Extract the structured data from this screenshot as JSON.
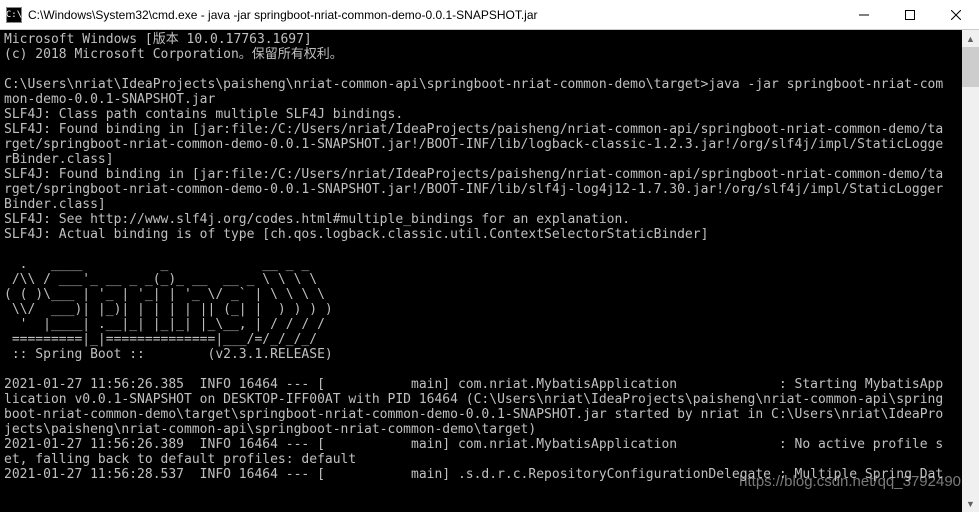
{
  "titlebar": {
    "icon_text": "C:\\",
    "title": "C:\\Windows\\System32\\cmd.exe - java  -jar springboot-nriat-common-demo-0.0.1-SNAPSHOT.jar"
  },
  "console": {
    "line1": "Microsoft Windows [版本 10.0.17763.1697]",
    "line2": "(c) 2018 Microsoft Corporation。保留所有权利。",
    "line3": "",
    "line4": "C:\\Users\\nriat\\IdeaProjects\\paisheng\\nriat-common-api\\springboot-nriat-common-demo\\target>java -jar springboot-nriat-com",
    "line5": "mon-demo-0.0.1-SNAPSHOT.jar",
    "line6": "SLF4J: Class path contains multiple SLF4J bindings.",
    "line7": "SLF4J: Found binding in [jar:file:/C:/Users/nriat/IdeaProjects/paisheng/nriat-common-api/springboot-nriat-common-demo/ta",
    "line8": "rget/springboot-nriat-common-demo-0.0.1-SNAPSHOT.jar!/BOOT-INF/lib/logback-classic-1.2.3.jar!/org/slf4j/impl/StaticLogge",
    "line9": "rBinder.class]",
    "line10": "SLF4J: Found binding in [jar:file:/C:/Users/nriat/IdeaProjects/paisheng/nriat-common-api/springboot-nriat-common-demo/ta",
    "line11": "rget/springboot-nriat-common-demo-0.0.1-SNAPSHOT.jar!/BOOT-INF/lib/slf4j-log4j12-1.7.30.jar!/org/slf4j/impl/StaticLogger",
    "line12": "Binder.class]",
    "line13": "SLF4J: See http://www.slf4j.org/codes.html#multiple_bindings for an explanation.",
    "line14": "SLF4J: Actual binding is of type [ch.qos.logback.classic.util.ContextSelectorStaticBinder]",
    "line15": "",
    "banner1": "  .   ____          _            __ _ _",
    "banner2": " /\\\\ / ___'_ __ _ _(_)_ __  __ _ \\ \\ \\ \\",
    "banner3": "( ( )\\___ | '_ | '_| | '_ \\/ _` | \\ \\ \\ \\",
    "banner4": " \\\\/  ___)| |_)| | | | | || (_| |  ) ) ) )",
    "banner5": "  '  |____| .__|_| |_|_| |_\\__, | / / / /",
    "banner6": " =========|_|==============|___/=/_/_/_/",
    "banner7": " :: Spring Boot ::        (v2.3.1.RELEASE)",
    "line16": "",
    "line17": "2021-01-27 11:56:26.385  INFO 16464 --- [           main] com.nriat.MybatisApplication             : Starting MybatisApp",
    "line18": "lication v0.0.1-SNAPSHOT on DESKTOP-IFF00AT with PID 16464 (C:\\Users\\nriat\\IdeaProjects\\paisheng\\nriat-common-api\\spring",
    "line19": "boot-nriat-common-demo\\target\\springboot-nriat-common-demo-0.0.1-SNAPSHOT.jar started by nriat in C:\\Users\\nriat\\IdeaPro",
    "line20": "jects\\paisheng\\nriat-common-api\\springboot-nriat-common-demo\\target)",
    "line21": "2021-01-27 11:56:26.389  INFO 16464 --- [           main] com.nriat.MybatisApplication             : No active profile s",
    "line22": "et, falling back to default profiles: default",
    "line23": "2021-01-27 11:56:28.537  INFO 16464 --- [           main] .s.d.r.c.RepositoryConfigurationDelegate : Multiple Spring Dat"
  },
  "watermark": "https://blog.csdn.net/qq_3792490"
}
